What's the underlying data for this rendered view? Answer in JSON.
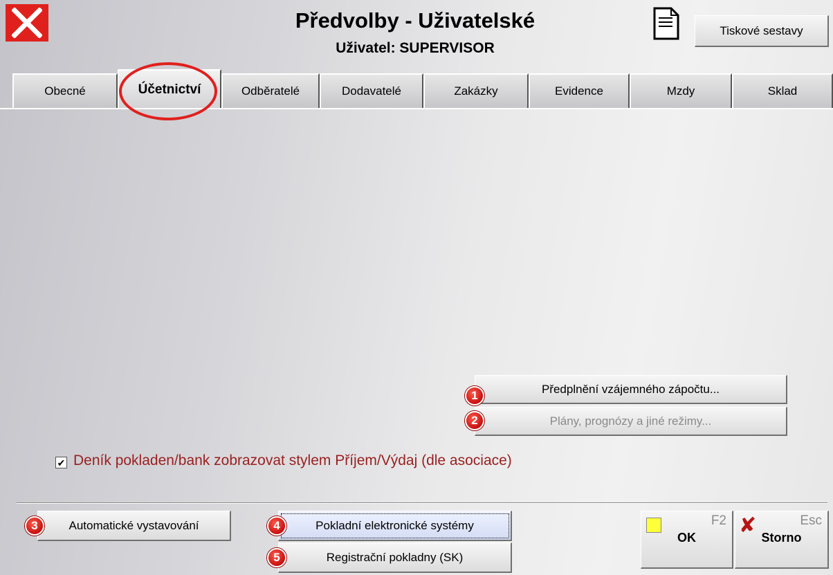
{
  "header": {
    "title": "Předvolby - Uživatelské",
    "subtitle": "Uživatel: SUPERVISOR",
    "print_reports_label": "Tiskové sestavy"
  },
  "tabs": [
    {
      "label": "Obecné",
      "active": false
    },
    {
      "label": "Účetnictví",
      "active": true
    },
    {
      "label": "Odběratelé",
      "active": false
    },
    {
      "label": "Dodavatelé",
      "active": false
    },
    {
      "label": "Zakázky",
      "active": false
    },
    {
      "label": "Evidence",
      "active": false
    },
    {
      "label": "Mzdy",
      "active": false
    },
    {
      "label": "Sklad",
      "active": false
    }
  ],
  "panel": {
    "prefill_label": "Předplnění vzájemného zápočtu...",
    "plans_label": "Plány, prognózy a jiné režimy...",
    "checkbox_label": "Deník pokladen/bank zobrazovat stylem Příjem/Výdaj (dle asociace)",
    "checkbox_checked": true
  },
  "footer": {
    "auto_issue_label": "Automatické vystavování",
    "eet_label": "Pokladní elektronické systémy",
    "cash_registers_label": "Registrační pokladny (SK)",
    "ok_label": "OK",
    "ok_key": "F2",
    "cancel_label": "Storno",
    "cancel_key": "Esc"
  },
  "badges": [
    "1",
    "2",
    "3",
    "4",
    "5"
  ],
  "icons": {
    "close": "close-icon",
    "document": "document-icon",
    "ok": "yellow-pencil-icon",
    "cancel": "red-x-icon"
  },
  "colors": {
    "accent_red": "#e0201d",
    "checkbox_label_color": "#9a1f1f"
  }
}
